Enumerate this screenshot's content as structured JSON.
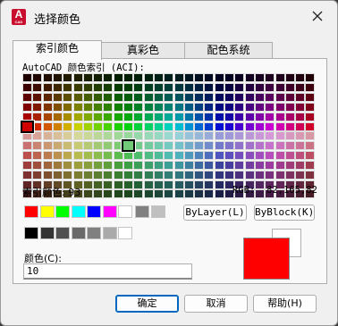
{
  "window": {
    "title": "选择颜色",
    "icon_letter": "A",
    "icon_sub": "CAD"
  },
  "tabs": [
    {
      "label": "索引颜色"
    },
    {
      "label": "真彩色"
    },
    {
      "label": "配色系统"
    }
  ],
  "aci": {
    "label": "AutoCAD 颜色索引 (ACI):",
    "index_label": "索引颜色: 93",
    "rgb_label": "RGB:",
    "rgb_value": "82,165,82",
    "selected_top": "red",
    "selected_bottom_index": 93
  },
  "standard_colors": [
    "#ff0000",
    "#ffff00",
    "#00ff00",
    "#00ffff",
    "#0000ff",
    "#ff00ff",
    "#ffffff"
  ],
  "grays_row1": [
    "#808080",
    "#c0c0c0"
  ],
  "grays_row2": [
    "#000000",
    "#333333",
    "#505050",
    "#696969",
    "#808080",
    "#aaaaaa",
    "#ffffff"
  ],
  "buttons": {
    "bylayer": "ByLayer(L)",
    "byblock": "ByBlock(K)",
    "ok": "确定",
    "cancel": "取消",
    "help": "帮助(H)"
  },
  "color": {
    "label": "颜色(C):",
    "value": "10"
  },
  "preview": {
    "old": "#ffffff",
    "new": "#ff0000"
  },
  "colors": {
    "accent": "#0067c0",
    "icon": "#c8102e"
  }
}
